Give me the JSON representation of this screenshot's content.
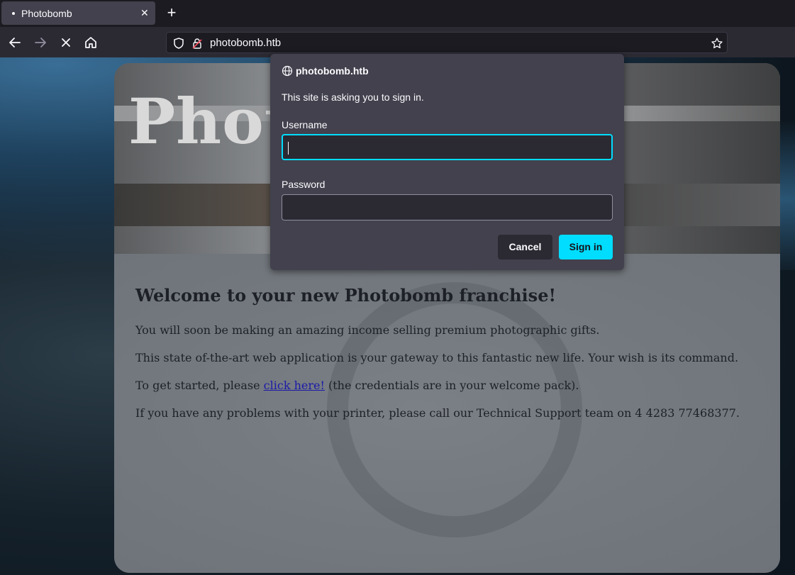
{
  "browser": {
    "tab": {
      "title": "Photobomb"
    },
    "new_tab_label": "+",
    "close_tab_glyph": "✕",
    "url": "photobomb.htb"
  },
  "page": {
    "hero_title": "Phot",
    "welcome_heading": "Welcome to your new Photobomb franchise!",
    "para1": "You will soon be making an amazing income selling premium photographic gifts.",
    "para2": "This state of-the-art web application is your gateway to this fantastic new life. Your wish is its command.",
    "para3_before": "To get started, please ",
    "para3_link": "click here!",
    "para3_after": " (the credentials are in your welcome pack).",
    "para4": "If you have any problems with your printer, please call our Technical Support team on 4 4283 77468377."
  },
  "auth_dialog": {
    "host": "photobomb.htb",
    "message": "This site is asking you to sign in.",
    "username_label": "Username",
    "username_value": "",
    "password_label": "Password",
    "password_value": "",
    "cancel_label": "Cancel",
    "signin_label": "Sign in"
  },
  "colors": {
    "accent": "#00ddff",
    "dialog_bg": "#42414d",
    "toolbar_bg": "#2b2a33",
    "link": "#1b1aa8"
  },
  "icons": [
    "back-arrow-icon",
    "forward-arrow-icon",
    "stop-icon",
    "home-icon",
    "shield-icon",
    "lock-icon",
    "star-icon",
    "globe-icon"
  ]
}
